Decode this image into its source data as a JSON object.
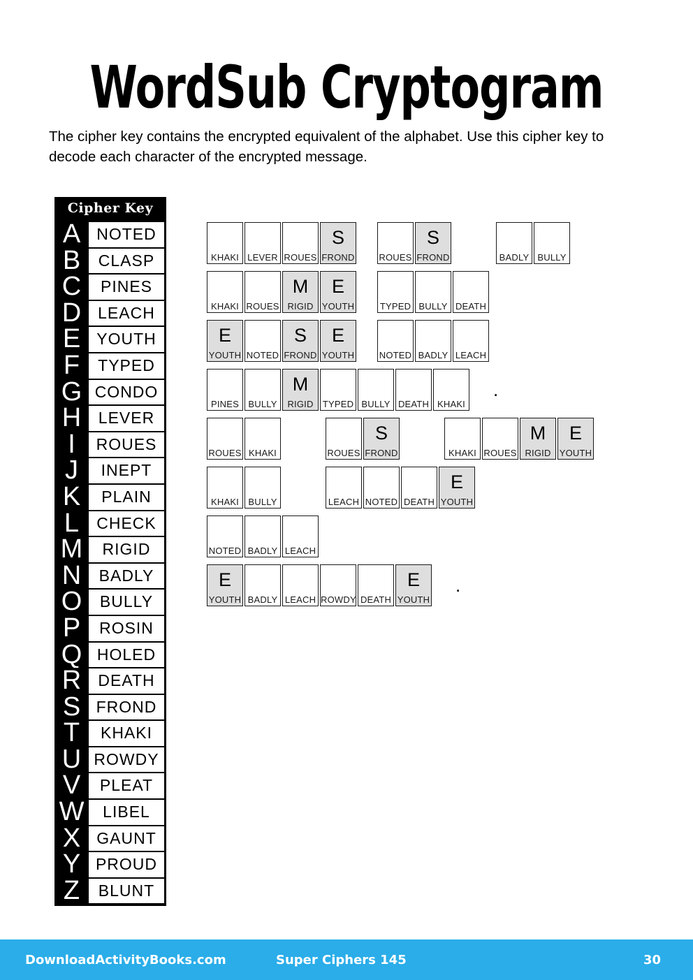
{
  "header": {
    "title": "WordSub Cryptogram",
    "instructions": "The cipher key contains the encrypted equivalent of the alphabet. Use this cipher key to decode each character of the encrypted message."
  },
  "cipher_key": {
    "header_label": "Cipher Key",
    "entries": [
      {
        "letter": "A",
        "word": "NOTED"
      },
      {
        "letter": "B",
        "word": "CLASP"
      },
      {
        "letter": "C",
        "word": "PINES"
      },
      {
        "letter": "D",
        "word": "LEACH"
      },
      {
        "letter": "E",
        "word": "YOUTH"
      },
      {
        "letter": "F",
        "word": "TYPED"
      },
      {
        "letter": "G",
        "word": "CONDO"
      },
      {
        "letter": "H",
        "word": "LEVER"
      },
      {
        "letter": "I",
        "word": "ROUES"
      },
      {
        "letter": "J",
        "word": "INEPT"
      },
      {
        "letter": "K",
        "word": "PLAIN"
      },
      {
        "letter": "L",
        "word": "CHECK"
      },
      {
        "letter": "M",
        "word": "RIGID"
      },
      {
        "letter": "N",
        "word": "BADLY"
      },
      {
        "letter": "O",
        "word": "BULLY"
      },
      {
        "letter": "P",
        "word": "ROSIN"
      },
      {
        "letter": "Q",
        "word": "HOLED"
      },
      {
        "letter": "R",
        "word": "DEATH"
      },
      {
        "letter": "S",
        "word": "FROND"
      },
      {
        "letter": "T",
        "word": "KHAKI"
      },
      {
        "letter": "U",
        "word": "ROWDY"
      },
      {
        "letter": "V",
        "word": "PLEAT"
      },
      {
        "letter": "W",
        "word": "LIBEL"
      },
      {
        "letter": "X",
        "word": "GAUNT"
      },
      {
        "letter": "Y",
        "word": "PROUD"
      },
      {
        "letter": "Z",
        "word": "BLUNT"
      }
    ]
  },
  "puzzle": {
    "rows": [
      {
        "words": [
          {
            "gap": "normal",
            "cells": [
              {
                "code": "KHAKI",
                "letter": "",
                "shaded": false
              },
              {
                "code": "LEVER",
                "letter": "",
                "shaded": false
              },
              {
                "code": "ROUES",
                "letter": "",
                "shaded": false
              },
              {
                "code": "FROND",
                "letter": "S",
                "shaded": true
              }
            ]
          },
          {
            "gap": "wide",
            "cells": [
              {
                "code": "ROUES",
                "letter": "",
                "shaded": false
              },
              {
                "code": "FROND",
                "letter": "S",
                "shaded": true
              }
            ]
          },
          {
            "gap": "normal",
            "cells": [
              {
                "code": "BADLY",
                "letter": "",
                "shaded": false
              },
              {
                "code": "BULLY",
                "letter": "",
                "shaded": false
              }
            ]
          }
        ],
        "period": false
      },
      {
        "words": [
          {
            "gap": "normal",
            "cells": [
              {
                "code": "KHAKI",
                "letter": "",
                "shaded": false
              },
              {
                "code": "ROUES",
                "letter": "",
                "shaded": false
              },
              {
                "code": "RIGID",
                "letter": "M",
                "shaded": true
              },
              {
                "code": "YOUTH",
                "letter": "E",
                "shaded": true
              }
            ]
          },
          {
            "gap": "normal",
            "cells": [
              {
                "code": "TYPED",
                "letter": "",
                "shaded": false
              },
              {
                "code": "BULLY",
                "letter": "",
                "shaded": false
              },
              {
                "code": "DEATH",
                "letter": "",
                "shaded": false
              }
            ]
          }
        ],
        "period": false
      },
      {
        "words": [
          {
            "gap": "normal",
            "cells": [
              {
                "code": "YOUTH",
                "letter": "E",
                "shaded": true
              },
              {
                "code": "NOTED",
                "letter": "",
                "shaded": false
              },
              {
                "code": "FROND",
                "letter": "S",
                "shaded": true
              },
              {
                "code": "YOUTH",
                "letter": "E",
                "shaded": true
              }
            ]
          },
          {
            "gap": "normal",
            "cells": [
              {
                "code": "NOTED",
                "letter": "",
                "shaded": false
              },
              {
                "code": "BADLY",
                "letter": "",
                "shaded": false
              },
              {
                "code": "LEACH",
                "letter": "",
                "shaded": false
              }
            ]
          }
        ],
        "period": false
      },
      {
        "words": [
          {
            "gap": "normal",
            "cells": [
              {
                "code": "PINES",
                "letter": "",
                "shaded": false
              },
              {
                "code": "BULLY",
                "letter": "",
                "shaded": false
              },
              {
                "code": "RIGID",
                "letter": "M",
                "shaded": true
              },
              {
                "code": "TYPED",
                "letter": "",
                "shaded": false
              },
              {
                "code": "BULLY",
                "letter": "",
                "shaded": false
              },
              {
                "code": "DEATH",
                "letter": "",
                "shaded": false
              },
              {
                "code": "KHAKI",
                "letter": "",
                "shaded": false
              }
            ]
          }
        ],
        "period": true
      },
      {
        "words": [
          {
            "gap": "wide",
            "cells": [
              {
                "code": "ROUES",
                "letter": "",
                "shaded": false
              },
              {
                "code": "KHAKI",
                "letter": "",
                "shaded": false
              }
            ]
          },
          {
            "gap": "wide",
            "cells": [
              {
                "code": "ROUES",
                "letter": "",
                "shaded": false
              },
              {
                "code": "FROND",
                "letter": "S",
                "shaded": true
              }
            ]
          },
          {
            "gap": "normal",
            "cells": [
              {
                "code": "KHAKI",
                "letter": "",
                "shaded": false
              },
              {
                "code": "ROUES",
                "letter": "",
                "shaded": false
              },
              {
                "code": "RIGID",
                "letter": "M",
                "shaded": true
              },
              {
                "code": "YOUTH",
                "letter": "E",
                "shaded": true
              }
            ]
          }
        ],
        "period": false
      },
      {
        "words": [
          {
            "gap": "wide",
            "cells": [
              {
                "code": "KHAKI",
                "letter": "",
                "shaded": false
              },
              {
                "code": "BULLY",
                "letter": "",
                "shaded": false
              }
            ]
          },
          {
            "gap": "normal",
            "cells": [
              {
                "code": "LEACH",
                "letter": "",
                "shaded": false
              },
              {
                "code": "NOTED",
                "letter": "",
                "shaded": false
              },
              {
                "code": "DEATH",
                "letter": "",
                "shaded": false
              },
              {
                "code": "YOUTH",
                "letter": "E",
                "shaded": true
              }
            ]
          }
        ],
        "period": false
      },
      {
        "words": [
          {
            "gap": "normal",
            "cells": [
              {
                "code": "NOTED",
                "letter": "",
                "shaded": false
              },
              {
                "code": "BADLY",
                "letter": "",
                "shaded": false
              },
              {
                "code": "LEACH",
                "letter": "",
                "shaded": false
              }
            ]
          }
        ],
        "period": false
      },
      {
        "words": [
          {
            "gap": "normal",
            "cells": [
              {
                "code": "YOUTH",
                "letter": "E",
                "shaded": true
              },
              {
                "code": "BADLY",
                "letter": "",
                "shaded": false
              },
              {
                "code": "LEACH",
                "letter": "",
                "shaded": false
              },
              {
                "code": "ROWDY",
                "letter": "",
                "shaded": false
              },
              {
                "code": "DEATH",
                "letter": "",
                "shaded": false
              },
              {
                "code": "YOUTH",
                "letter": "E",
                "shaded": true
              }
            ]
          }
        ],
        "period": true
      }
    ],
    "period_symbol": "."
  },
  "footer": {
    "site": "DownloadActivityBooks.com",
    "book": "Super Ciphers 145",
    "page": "30",
    "background_color": "#2aade9"
  }
}
